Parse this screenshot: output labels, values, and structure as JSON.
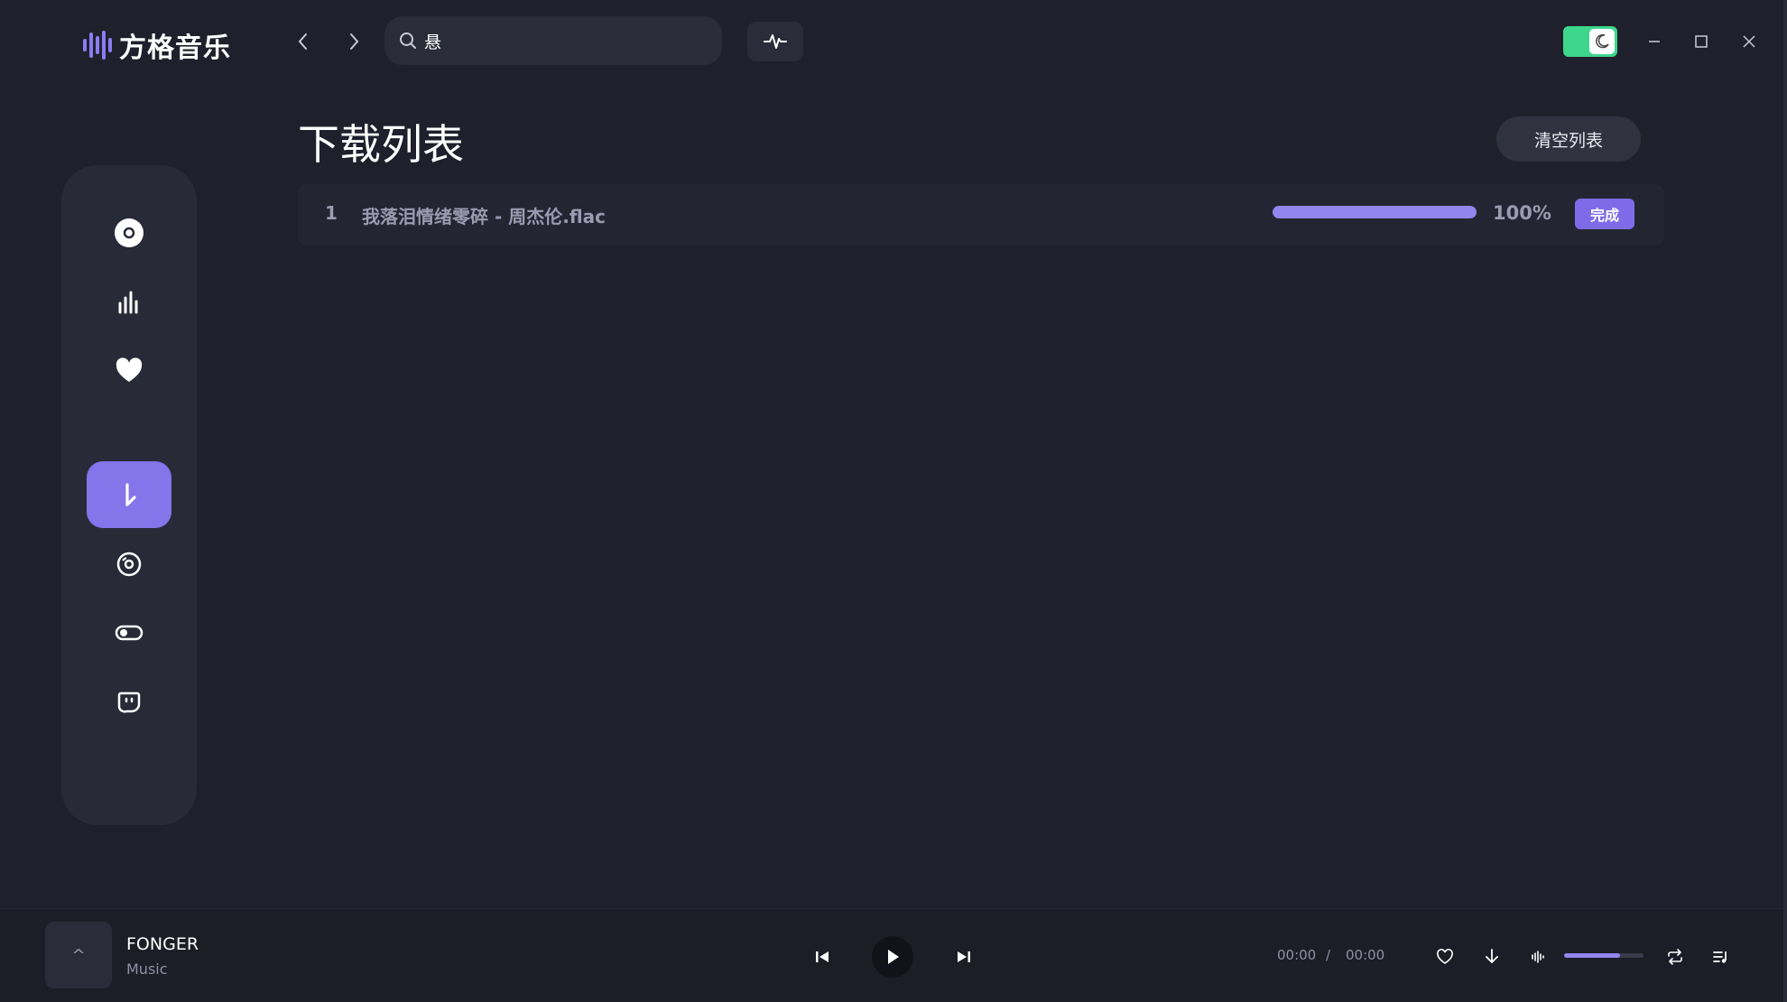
{
  "app": {
    "name": "方格音乐"
  },
  "search": {
    "value": "悬"
  },
  "page": {
    "title": "下载列表",
    "clear_label": "清空列表"
  },
  "downloads": [
    {
      "index": "1",
      "name": "我落泪情绪零碎 - 周杰伦.flac",
      "progress": 1.0,
      "percent_text": "100%",
      "status": "完成"
    }
  ],
  "player": {
    "track_title": "FONGER",
    "track_artist": "Music",
    "cover_glyph": "^",
    "time_current": "00:00",
    "time_separator": "/",
    "time_total": "00:00",
    "volume": 0.7
  },
  "colors": {
    "accent": "#8574ea",
    "toggle": "#3ed68c",
    "background": "#1f202c",
    "sidebar": "#292a38"
  },
  "icons": {
    "sidebar": [
      "disc-icon",
      "chart-icon",
      "heart-icon",
      "download-icon",
      "cd-icon",
      "toggle-icon",
      "chat-icon"
    ]
  }
}
